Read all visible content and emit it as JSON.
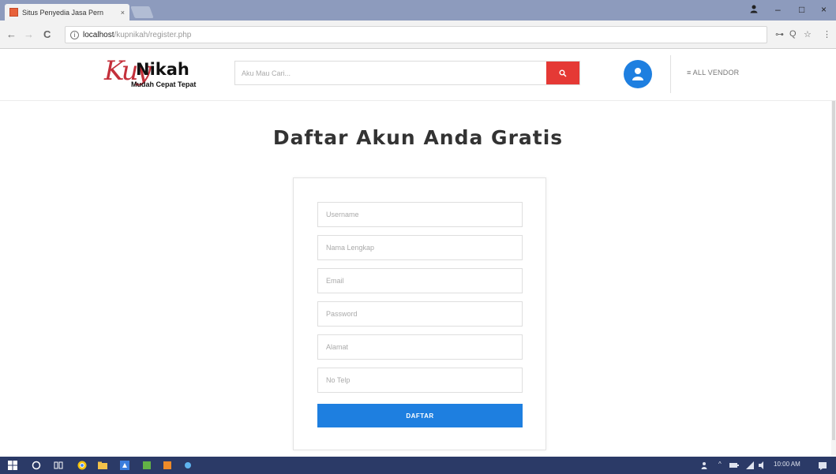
{
  "browser": {
    "tab_title": "Situs Penyedia Jasa Pern",
    "tab_close": "×",
    "url_host": "localhost",
    "url_path": "/kupnikah/register.php",
    "back": "←",
    "forward": "→",
    "reload": "C",
    "info": "i",
    "min": "–",
    "max": "□",
    "close": "×",
    "key": "⊶",
    "zoom": "Q",
    "star": "☆",
    "menu": "⋮"
  },
  "header": {
    "logo_script": "Kuy",
    "logo_word": "Nikah",
    "logo_tagline": "Mudah Cepat Tepat",
    "search_placeholder": "Aku Mau Cari...",
    "vendor_link": "≡ ALL VENDOR"
  },
  "main": {
    "title": "Daftar Akun Anda Gratis",
    "fields": {
      "username": "Username",
      "fullname": "Nama Lengkap",
      "email": "Email",
      "password": "Password",
      "address": "Alamat",
      "phone": "No Telp"
    },
    "submit_label": "DAFTAR"
  },
  "taskbar": {
    "clock": "10:00 AM"
  },
  "colors": {
    "brand_blue": "#1e7fe0",
    "search_red": "#e53935",
    "logo_red": "#c4303b",
    "taskbar": "#2b3a67"
  }
}
